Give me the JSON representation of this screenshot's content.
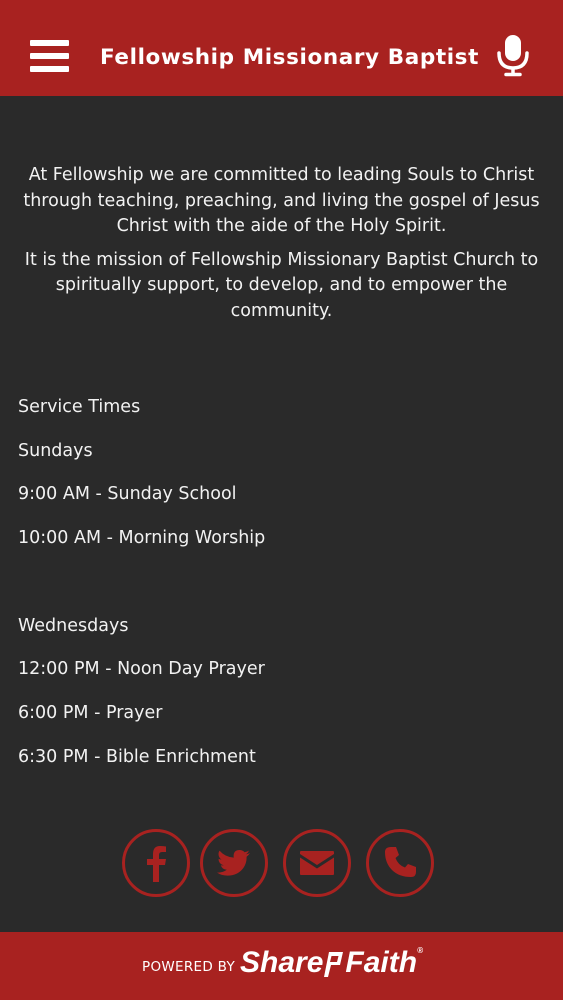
{
  "header": {
    "title": "Fellowship Missionary Baptist",
    "menu_icon": "hamburger-menu-icon",
    "mic_icon": "microphone-icon",
    "background": "#a82220"
  },
  "intro": {
    "paragraph1_lines": [
      "At Fellowship we are committed to leading Souls to Christ",
      "through teaching,  preaching, and living the gospel of Jesus",
      "Christ with the aide of the Holy Spirit."
    ],
    "paragraph2_lines": [
      "It is the mission of Fellowship Missionary Baptist Church to",
      "spiritually support, to develop, and to empower the",
      "community."
    ]
  },
  "services": {
    "heading": "Service Times",
    "sunday_label": "Sundays",
    "sunday_items": [
      "9:00 AM - Sunday School",
      "10:00 AM - Morning Worship"
    ],
    "wednesday_label": "Wednesdays",
    "wednesday_items": [
      "12:00 PM - Noon Day Prayer",
      "6:00 PM - Prayer",
      "6:30 PM - Bible Enrichment"
    ]
  },
  "social": {
    "icons": [
      "facebook-icon",
      "twitter-icon",
      "email-icon",
      "phone-icon"
    ],
    "color": "#a82220"
  },
  "footer": {
    "powered_by": "POWERED BY",
    "brand_part1": "Share",
    "brand_part2": "Faith",
    "trademark": "®"
  },
  "colors": {
    "accent": "#a82220",
    "background": "#2a2a2a",
    "text": "#f2f2f2"
  }
}
